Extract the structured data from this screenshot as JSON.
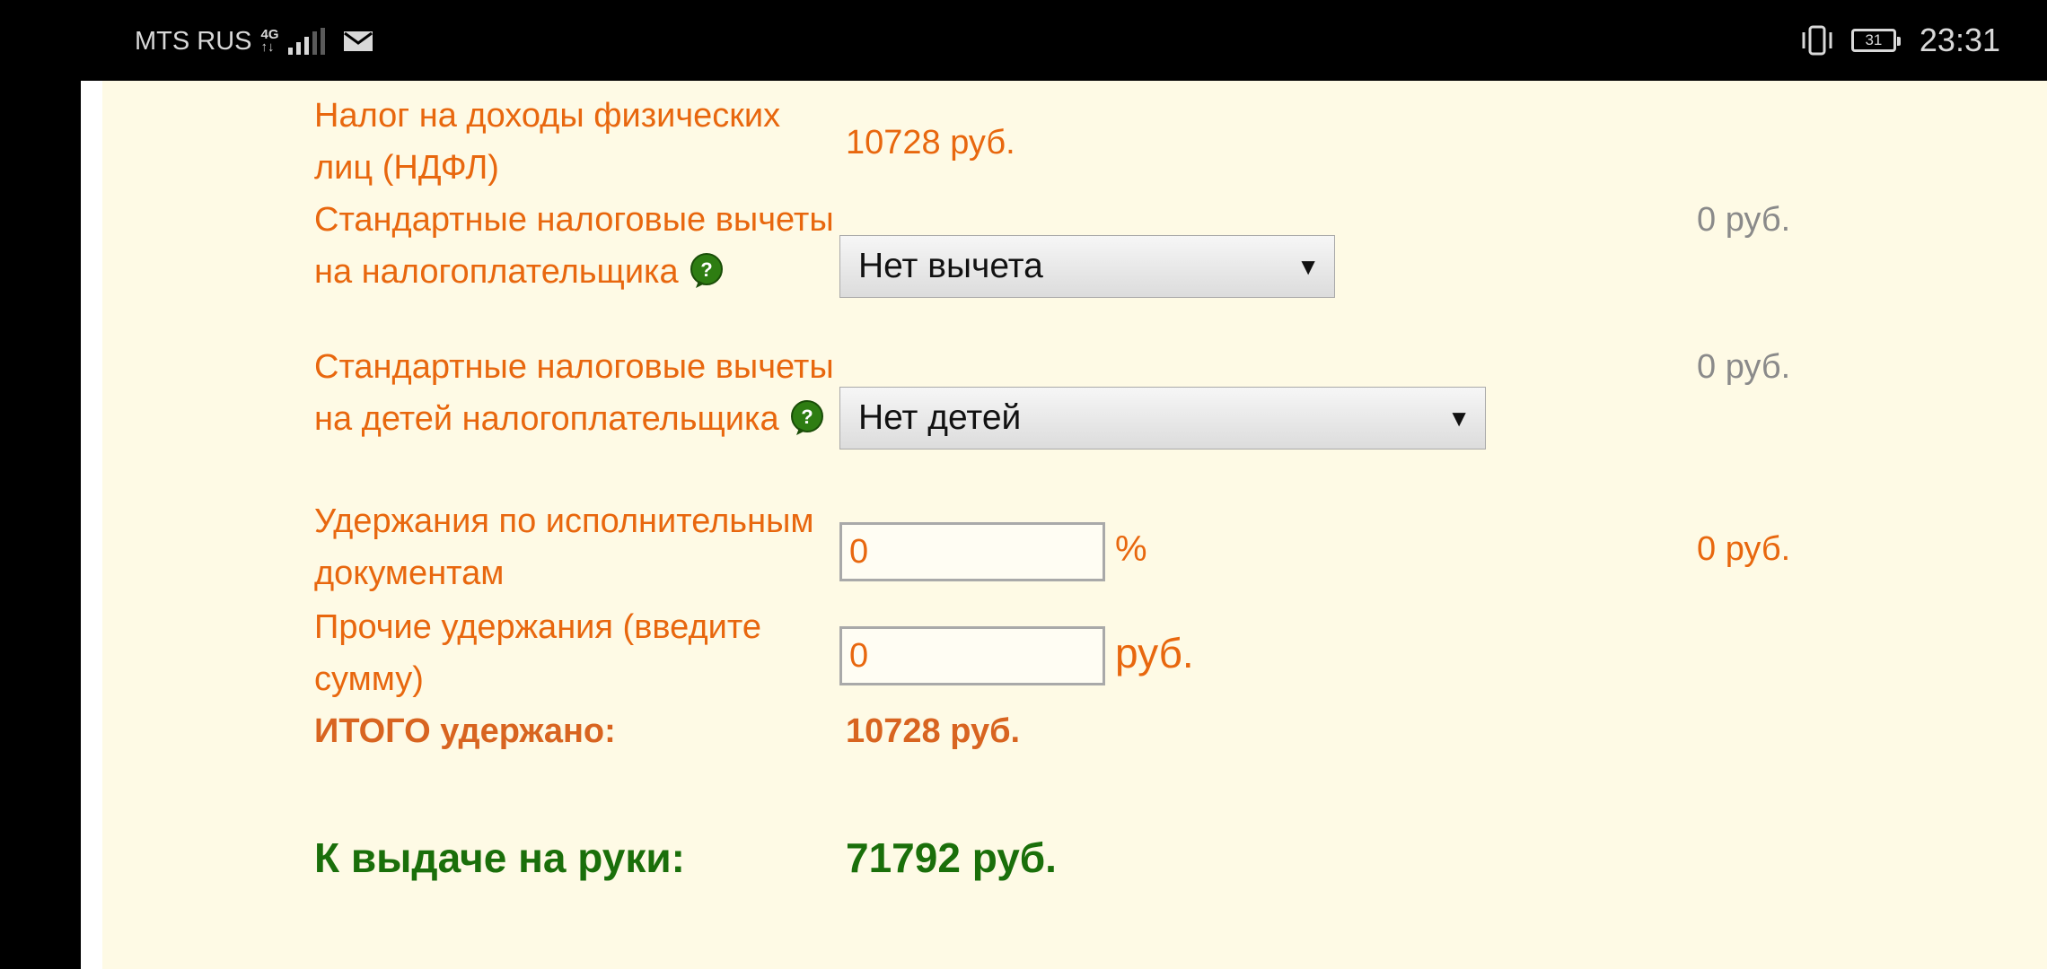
{
  "status_bar": {
    "carrier": "MTS RUS",
    "network_top": "4G",
    "network_bottom": "↑↓",
    "battery": "31",
    "time": "23:31"
  },
  "form": {
    "ndfl": {
      "label": "Налог на доходы физических лиц (НДФЛ)",
      "value": "10728 руб."
    },
    "taxpayer_deduction": {
      "label": "Стандартные налоговые вычеты на налогоплательщика",
      "selected": "Нет вычета",
      "amount": "0 руб."
    },
    "children_deduction": {
      "label": "Стандартные налоговые вычеты на детей налогоплательщика",
      "selected": "Нет детей",
      "amount": "0 руб."
    },
    "writs": {
      "label": "Удержания по исполнительным документам",
      "value": "0",
      "unit": "%",
      "amount": "0 руб."
    },
    "other": {
      "label": "Прочие удержания (введите сумму)",
      "value": "0",
      "unit": "руб."
    },
    "total": {
      "label": "ИТОГО удержано:",
      "value": "10728 руб."
    },
    "payout": {
      "label": "К выдаче на руки:",
      "value": "71792 руб."
    }
  },
  "colors": {
    "orange": "#e8670e",
    "green": "#1a6f0a",
    "background": "#fefae5"
  }
}
